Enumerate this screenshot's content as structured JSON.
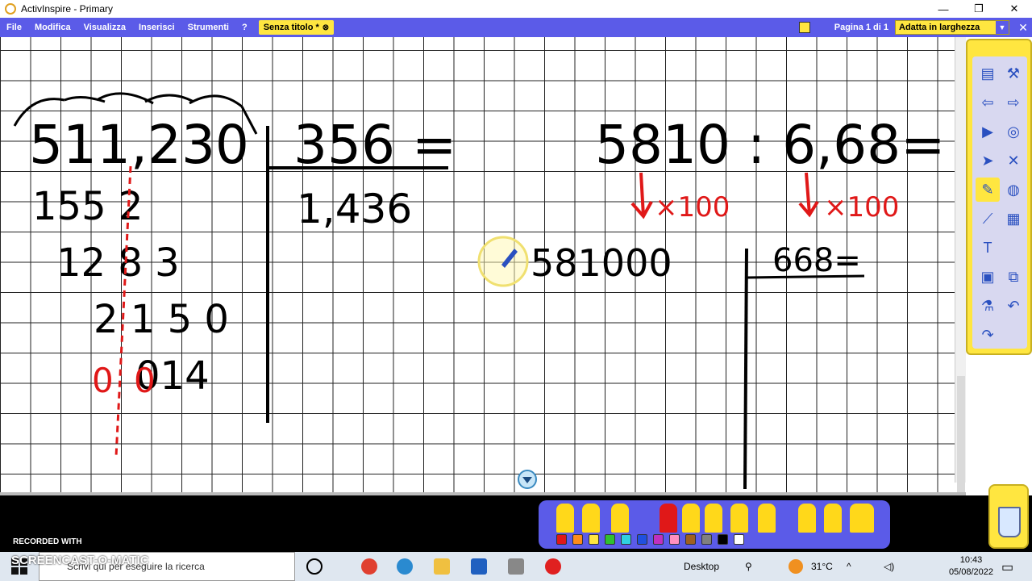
{
  "window": {
    "title": "ActivInspire - Primary",
    "controls": [
      "—",
      "❐",
      "✕"
    ]
  },
  "menu": {
    "items": [
      "File",
      "Modifica",
      "Visualizza",
      "Inserisci",
      "Strumenti",
      "?"
    ],
    "doc_tab": "Senza titolo *",
    "page_label": "Pagina 1 di 1",
    "zoom_value": "Adatta in larghezza"
  },
  "board": {
    "left": {
      "dividend": "511,230",
      "divisor_expr": "356 =",
      "quotient": "1,436",
      "steps": [
        "155 2",
        "12 8 3",
        "2 1 5 0",
        "014"
      ],
      "red_zero": "0",
      "red_comma_zero": "0"
    },
    "right": {
      "expression": "5810 : 6,68=",
      "mult_left": "×100",
      "mult_right": "×100",
      "new_dividend": "581000",
      "new_divisor": "668="
    }
  },
  "recorder": {
    "label": "RECORDED WITH",
    "brand": "SCREENCAST-O-MATIC"
  },
  "taskbar": {
    "search_placeholder": "Scrivi qui per eseguire la ricerca",
    "desktop_label": "Desktop",
    "weather": "31°C",
    "time": "10:43",
    "date": "05/08/2022"
  },
  "colors": {
    "menu": "#5b5be8",
    "accent": "#ffe640",
    "ink": "#000000",
    "red_ink": "#e01818"
  },
  "icons": [
    "activinspire-icon",
    "pen-icon",
    "trash-icon",
    "windows-start-icon"
  ]
}
